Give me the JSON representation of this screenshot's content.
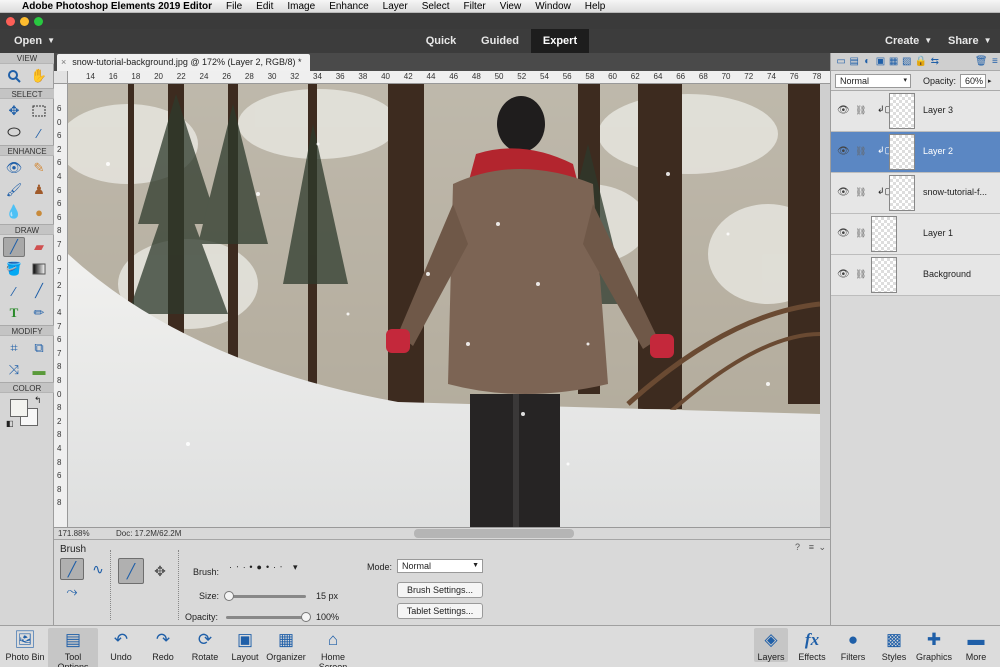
{
  "menubar": {
    "app_name": "Adobe Photoshop Elements 2019 Editor",
    "items": [
      "File",
      "Edit",
      "Image",
      "Enhance",
      "Layer",
      "Select",
      "Filter",
      "View",
      "Window",
      "Help"
    ]
  },
  "modebar": {
    "open_label": "Open",
    "tabs": [
      {
        "label": "Quick",
        "active": false
      },
      {
        "label": "Guided",
        "active": false
      },
      {
        "label": "Expert",
        "active": true
      }
    ],
    "create_label": "Create",
    "share_label": "Share"
  },
  "toolbox": {
    "sections": {
      "view": "VIEW",
      "select": "SELECT",
      "enhance": "ENHANCE",
      "draw": "DRAW",
      "modify": "MODIFY",
      "color": "COLOR"
    }
  },
  "document": {
    "tab_title": "snow-tutorial-background.jpg @ 172% (Layer 2, RGB/8) *",
    "ruler_top": [
      "14",
      "16",
      "18",
      "20",
      "22",
      "24",
      "26",
      "28",
      "30",
      "32",
      "34",
      "36",
      "38",
      "40",
      "42",
      "44",
      "46",
      "48",
      "50",
      "52",
      "54",
      "56",
      "58",
      "60",
      "62",
      "64",
      "66",
      "68",
      "70",
      "72",
      "74",
      "76",
      "78"
    ],
    "ruler_left": [
      "6",
      "0",
      "6",
      "2",
      "6",
      "4",
      "6",
      "6",
      "6",
      "8",
      "7",
      "0",
      "7",
      "2",
      "7",
      "4",
      "7",
      "6",
      "7",
      "8",
      "8",
      "0",
      "8",
      "2",
      "8",
      "4",
      "8",
      "6",
      "8",
      "8"
    ],
    "zoom": "171.88%",
    "doc_info": "Doc: 17.2M/62.2M"
  },
  "layers_panel": {
    "blend_mode": "Normal",
    "opacity_label": "Opacity:",
    "opacity_value": "60%",
    "layers": [
      {
        "name": "Layer 3",
        "active": false,
        "indent": true
      },
      {
        "name": "Layer 2",
        "active": true,
        "indent": true
      },
      {
        "name": "snow-tutorial-f...",
        "active": false,
        "indent": true
      },
      {
        "name": "Layer 1",
        "active": false,
        "indent": false
      },
      {
        "name": "Background",
        "active": false,
        "indent": false
      }
    ]
  },
  "tool_options": {
    "title": "Brush",
    "brush_label": "Brush:",
    "size_label": "Size:",
    "size_value": "15 px",
    "size_fraction": 0.04,
    "opacity_label": "Opacity:",
    "opacity_value": "100%",
    "opacity_fraction": 1.0,
    "mode_label": "Mode:",
    "mode_value": "Normal",
    "brush_settings": "Brush Settings...",
    "tablet_settings": "Tablet Settings..."
  },
  "taskbar": {
    "left": [
      {
        "label": "Photo Bin",
        "icon": "photo-bin-icon"
      },
      {
        "label": "Tool Options",
        "icon": "tool-options-icon"
      },
      {
        "label": "Undo",
        "icon": "undo-icon"
      },
      {
        "label": "Redo",
        "icon": "redo-icon"
      },
      {
        "label": "Rotate",
        "icon": "rotate-icon"
      },
      {
        "label": "Layout",
        "icon": "layout-icon"
      },
      {
        "label": "Organizer",
        "icon": "organizer-icon"
      },
      {
        "label": "Home Screen",
        "icon": "home-icon"
      }
    ],
    "right": [
      {
        "label": "Layers",
        "icon": "layers-icon"
      },
      {
        "label": "Effects",
        "icon": "fx-icon"
      },
      {
        "label": "Filters",
        "icon": "filters-icon"
      },
      {
        "label": "Styles",
        "icon": "styles-icon"
      },
      {
        "label": "Graphics",
        "icon": "graphics-icon"
      },
      {
        "label": "More",
        "icon": "more-icon"
      }
    ]
  },
  "colors": {
    "accent": "#1f5fa8",
    "active_layer": "#5b87c3"
  }
}
